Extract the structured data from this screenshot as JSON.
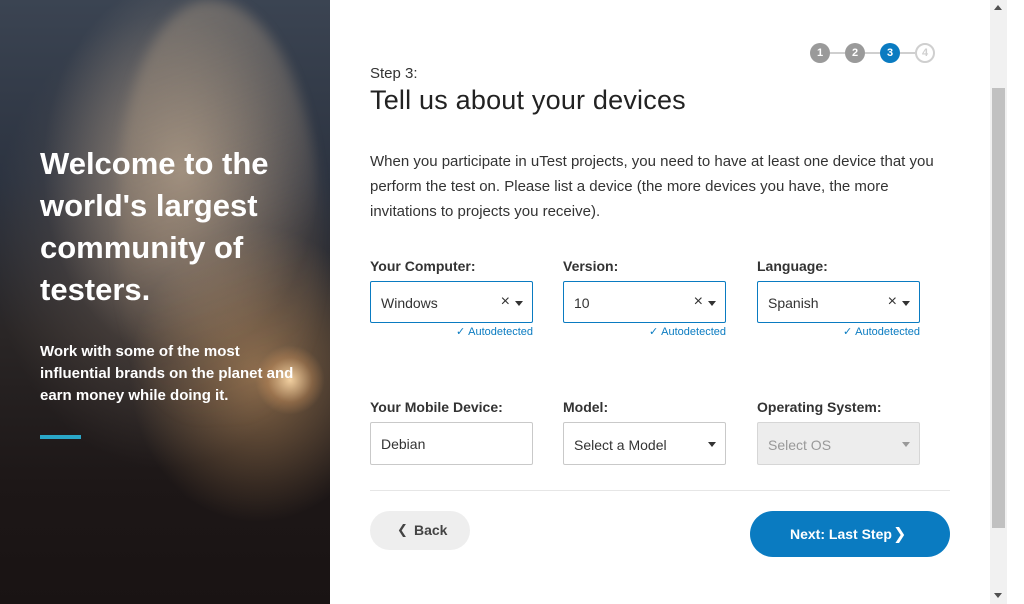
{
  "hero": {
    "heading": "Welcome to the world's largest community of testers.",
    "subheading": "Work with some of the most influential brands on the planet and earn money while doing it."
  },
  "progress": {
    "steps": [
      "1",
      "2",
      "3",
      "4"
    ],
    "current_step": 3
  },
  "form": {
    "step_label": "Step 3:",
    "title": "Tell us about your devices",
    "intro": "When you participate in uTest projects, you need to have at least one device that you perform the test on. Please list a device (the more devices you have, the more invitations to projects you receive).",
    "computer": {
      "label": "Your Computer:",
      "value": "Windows",
      "clear": "×",
      "hint": "Autodetected"
    },
    "version": {
      "label": "Version:",
      "value": "10",
      "clear": "×",
      "hint": "Autodetected"
    },
    "language": {
      "label": "Language:",
      "value": "Spanish",
      "clear": "×",
      "hint": "Autodetected"
    },
    "mobile_device": {
      "label": "Your Mobile Device:",
      "value": "Debian"
    },
    "model": {
      "label": "Model:",
      "value": "Select a Model"
    },
    "os": {
      "label": "Operating System:",
      "value": "Select OS"
    }
  },
  "buttons": {
    "back": "Back",
    "next": "Next: Last Step"
  },
  "colors": {
    "accent": "#0a7bc1",
    "hero_bar": "#2aa7c8"
  }
}
